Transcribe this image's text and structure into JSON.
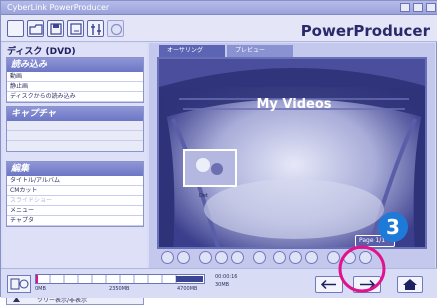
{
  "window": {
    "title": "CyberLink PowerProducer"
  },
  "toolbar": {
    "brand": "PowerProducer"
  },
  "left_panel": {
    "title": "ディスク (DVD)",
    "import_section": {
      "header": "読み込み",
      "items": [
        "動画",
        "静止画",
        "ディスクからの読み込み"
      ]
    },
    "capture_section": {
      "header": "キャプチャ"
    },
    "edit_section": {
      "header": "編集",
      "items": [
        "タイトル/アルバム",
        "CMカット",
        "スライドショー",
        "メニュー",
        "チャプタ"
      ]
    },
    "tree_toggle": "ツリー表示/非表示"
  },
  "preview": {
    "tabs": [
      "オーサリング",
      "プレビュー"
    ],
    "menu_title": "My Videos",
    "thumb_label": "Det",
    "page_label": "Page 1/1"
  },
  "capacity": {
    "ticks": [
      "0MB",
      "2350MB",
      "4700MB"
    ],
    "time": "00:00:16",
    "size": "30MB",
    "used_fraction": 0.01
  },
  "callout": {
    "number": "3"
  },
  "colors": {
    "accent": "#e0128c",
    "callout_blue": "#1e7ad8",
    "brand": "#2a2a6a"
  }
}
